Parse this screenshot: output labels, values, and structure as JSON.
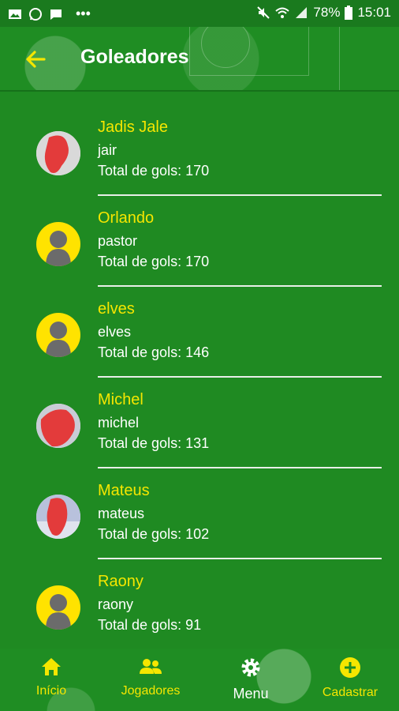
{
  "statusbar": {
    "battery": "78%",
    "time": "15:01"
  },
  "appbar": {
    "title": "Goleadores"
  },
  "players": [
    {
      "name": "Jadis Jale",
      "username": "jair",
      "gols": "Total de gols: 170",
      "avatar": "photo"
    },
    {
      "name": "Orlando",
      "username": "pastor",
      "gols": "Total de gols: 170",
      "avatar": "default"
    },
    {
      "name": "elves",
      "username": "elves",
      "gols": "Total de gols: 146",
      "avatar": "default"
    },
    {
      "name": "Michel",
      "username": "michel",
      "gols": "Total de gols: 131",
      "avatar": "photo"
    },
    {
      "name": "Mateus",
      "username": "mateus",
      "gols": "Total de gols: 102",
      "avatar": "photo"
    },
    {
      "name": "Raony",
      "username": "raony",
      "gols": "Total de gols: 91",
      "avatar": "default"
    }
  ],
  "nav": {
    "inicio": "Início",
    "jogadores": "Jogadores",
    "menu": "Menu",
    "cadastrar": "Cadastrar"
  },
  "colors": {
    "accent": "#f5e600",
    "background": "#1f8a22"
  }
}
